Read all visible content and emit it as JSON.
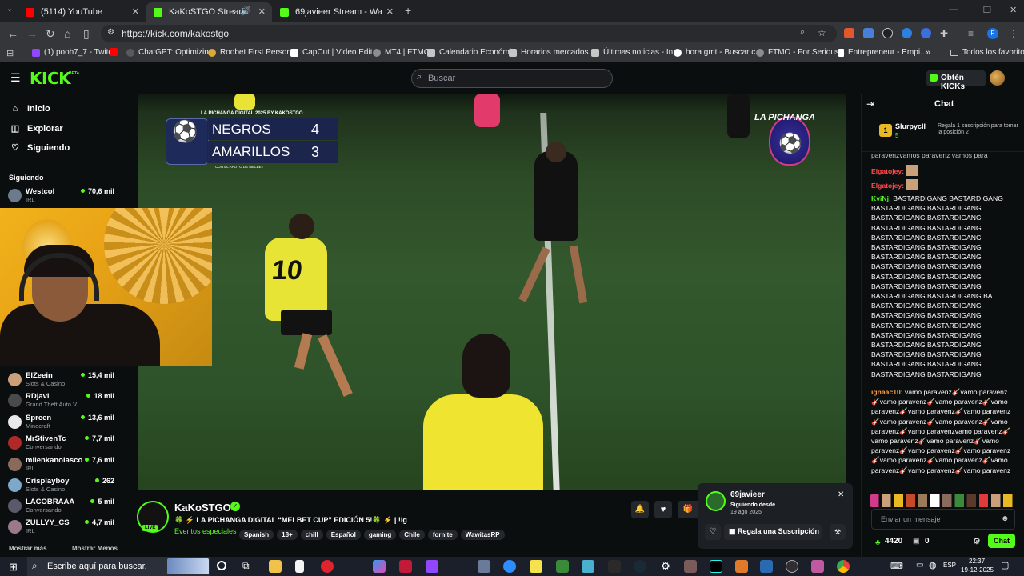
{
  "browser": {
    "tabs": [
      {
        "title": "(5114) YouTube",
        "active": false
      },
      {
        "title": "KaKoSTGO Stream - Watch",
        "active": true
      },
      {
        "title": "69javieer Stream - Watch Live o",
        "active": false
      }
    ],
    "new_tab_icon": "+",
    "url": "https://kick.com/kakostgo",
    "bookmarks": [
      "(1) pooh7_7 - Twitch",
      "ChatGPT: Optimizin...",
      "Roobet First Person...",
      "CapCut | Video Edit...",
      "MT4 | FTMO",
      "Calendario Económi...",
      "Horarios mercados...",
      "Últimas noticias - In...",
      "hora gmt - Buscar c...",
      "FTMO - For Serious...",
      "Entrepreneur - Empi..."
    ],
    "bookmarks_overflow": "»",
    "all_favorites": "Todos los favoritos",
    "profile_initial": "F"
  },
  "kick": {
    "logo": "KICK",
    "logo_badge": "BETA",
    "search_placeholder": "Buscar",
    "get_kicks": "Obtén KICKs"
  },
  "sidebar": {
    "nav": [
      {
        "label": "Inicio",
        "icon": "home-icon"
      },
      {
        "label": "Explorar",
        "icon": "compass-icon"
      },
      {
        "label": "Siguiendo",
        "icon": "heart-icon"
      }
    ],
    "following_title": "Siguiendo",
    "channels": [
      {
        "name": "Westcol",
        "sub": "IRL",
        "viewers": "70,6 mil",
        "color": "#6b7b8c"
      },
      {
        "name": "ElZeein",
        "sub": "Slots & Casino",
        "viewers": "15,4 mil",
        "color": "#c9a07a"
      },
      {
        "name": "RDjavi",
        "sub": "Grand Theft Auto V ...",
        "viewers": "18 mil",
        "color": "#4a4a4a"
      },
      {
        "name": "Spreen",
        "sub": "Minecraft",
        "viewers": "13,6 mil",
        "color": "#e9e9e9"
      },
      {
        "name": "MrStivenTc",
        "sub": "Conversando",
        "viewers": "7,7 mil",
        "color": "#b02828"
      },
      {
        "name": "milenkanolasco",
        "sub": "IRL",
        "viewers": "7,6 mil",
        "color": "#8a6a5a"
      },
      {
        "name": "Crisplayboy",
        "sub": "Slots & Casino",
        "viewers": "262",
        "color": "#7fa7c9"
      },
      {
        "name": "LACOBRAAA",
        "sub": "Conversando",
        "viewers": "5 mil",
        "color": "#5a5a6a"
      },
      {
        "name": "ZULLYY_CS",
        "sub": "IRL",
        "viewers": "4,7 mil",
        "color": "#9a7a8a"
      }
    ],
    "show_more": "Mostrar más",
    "show_less": "Mostrar Menos"
  },
  "video": {
    "scoreboard_title": "LA PICHANGA DIGITAL 2025 BY KAKOSTGO",
    "team1": "NEGROS",
    "score1": "4",
    "team2": "AMARILLOS",
    "score2": "3",
    "scoreboard_footer": "CON EL APOYO DE MELBET",
    "logo_text": "LA PICHANGA",
    "player_number": "10"
  },
  "stream": {
    "channel": "KaKoSTGO",
    "live_badge": "LIVE",
    "title": "🍀 ⚡ LA PICHANGA DIGITAL “MELBET CUP” EDICIÓN 5!🍀 ⚡ | !ig",
    "category": "Eventos especiales",
    "tags": [
      "Spanish",
      "18+",
      "chill",
      "Español",
      "gaming",
      "Chile",
      "fornite",
      "WawitasRP"
    ]
  },
  "chat": {
    "title": "Chat",
    "top_gifter": {
      "name": "Slurpycll",
      "rank": "1",
      "count": "5"
    },
    "gift_hint": "Regala 1 suscripción para tomar la posición 2",
    "messages": [
      {
        "user": "",
        "text": "paravenzvamos paravenz vamos para",
        "color": "#ffffff"
      },
      {
        "user": "Elgatojey:",
        "text": "",
        "color": "#ff4b4b"
      },
      {
        "user": "Elgatojey:",
        "text": "",
        "color": "#ff4b4b"
      },
      {
        "user": "KviNj:",
        "text": "BASTARDIGANG BASTARDIGANG BASTARDIGANG BASTARDIGANG BASTARDIGANG BASTARDIGANG BASTARDIGANG BASTARDIGANG BASTARDIGANG BASTARDIGANG BASTARDIGANG BASTARDIGANG BASTARDIGANG BASTARDIGANG BASTARDIGANG BASTARDIGANG BASTARDIGANG BASTARDIGANG BASTARDIGANG BASTARDIGANG BASTARDIGANG BASTARDIGANG BA BASTARDIGANG BASTARDIGANG BASTARDIGANG BASTARDIGANG BASTARDIGANG BASTARDIGANG BASTARDIGANG BASTARDIGANG BASTARDIGANG BASTARDIGANG BASTARDIGANG BASTARDIGANG BASTARDIGANG BASTARDIGANG BASTARDIGANG BASTARDIGANG BASTARDIGANG BASTARDIGANG",
        "color": "#53fc18"
      },
      {
        "user": "ignaac10:",
        "text": "vamo paravenz🎸vamo paravenz🎸vamo paravenz🎸vamo paravenz🎸vamo paravenz🎸vamo paravenz🎸vamo paravenz🎸vamo paravenz🎸vamo paravenz🎸vamo paravenz🎸vamo paravenzvamo paravenz🎸vamo paravenz🎸vamo paravenz🎸vamo paravenz🎸vamo paravenz🎸vamo paravenz🎸vamo paravenz🎸vamo paravenz🎸vamo paravenz🎸vamo paravenz🎸vamo paravenz",
        "color": "#ff9a3c"
      }
    ],
    "input_placeholder": "Enviar un mensaje",
    "points": "4420",
    "subs": "0",
    "send_button": "Chat"
  },
  "popup": {
    "user": "69javieer",
    "following_since_label": "Siguiendo desde",
    "following_since_date": "19 ago 2025",
    "gift_button": "Regala una Suscripción"
  },
  "taskbar": {
    "search_placeholder": "Escribe aquí para buscar.",
    "lang": "ESP",
    "time": "22:37",
    "date": "19-12-2025"
  }
}
